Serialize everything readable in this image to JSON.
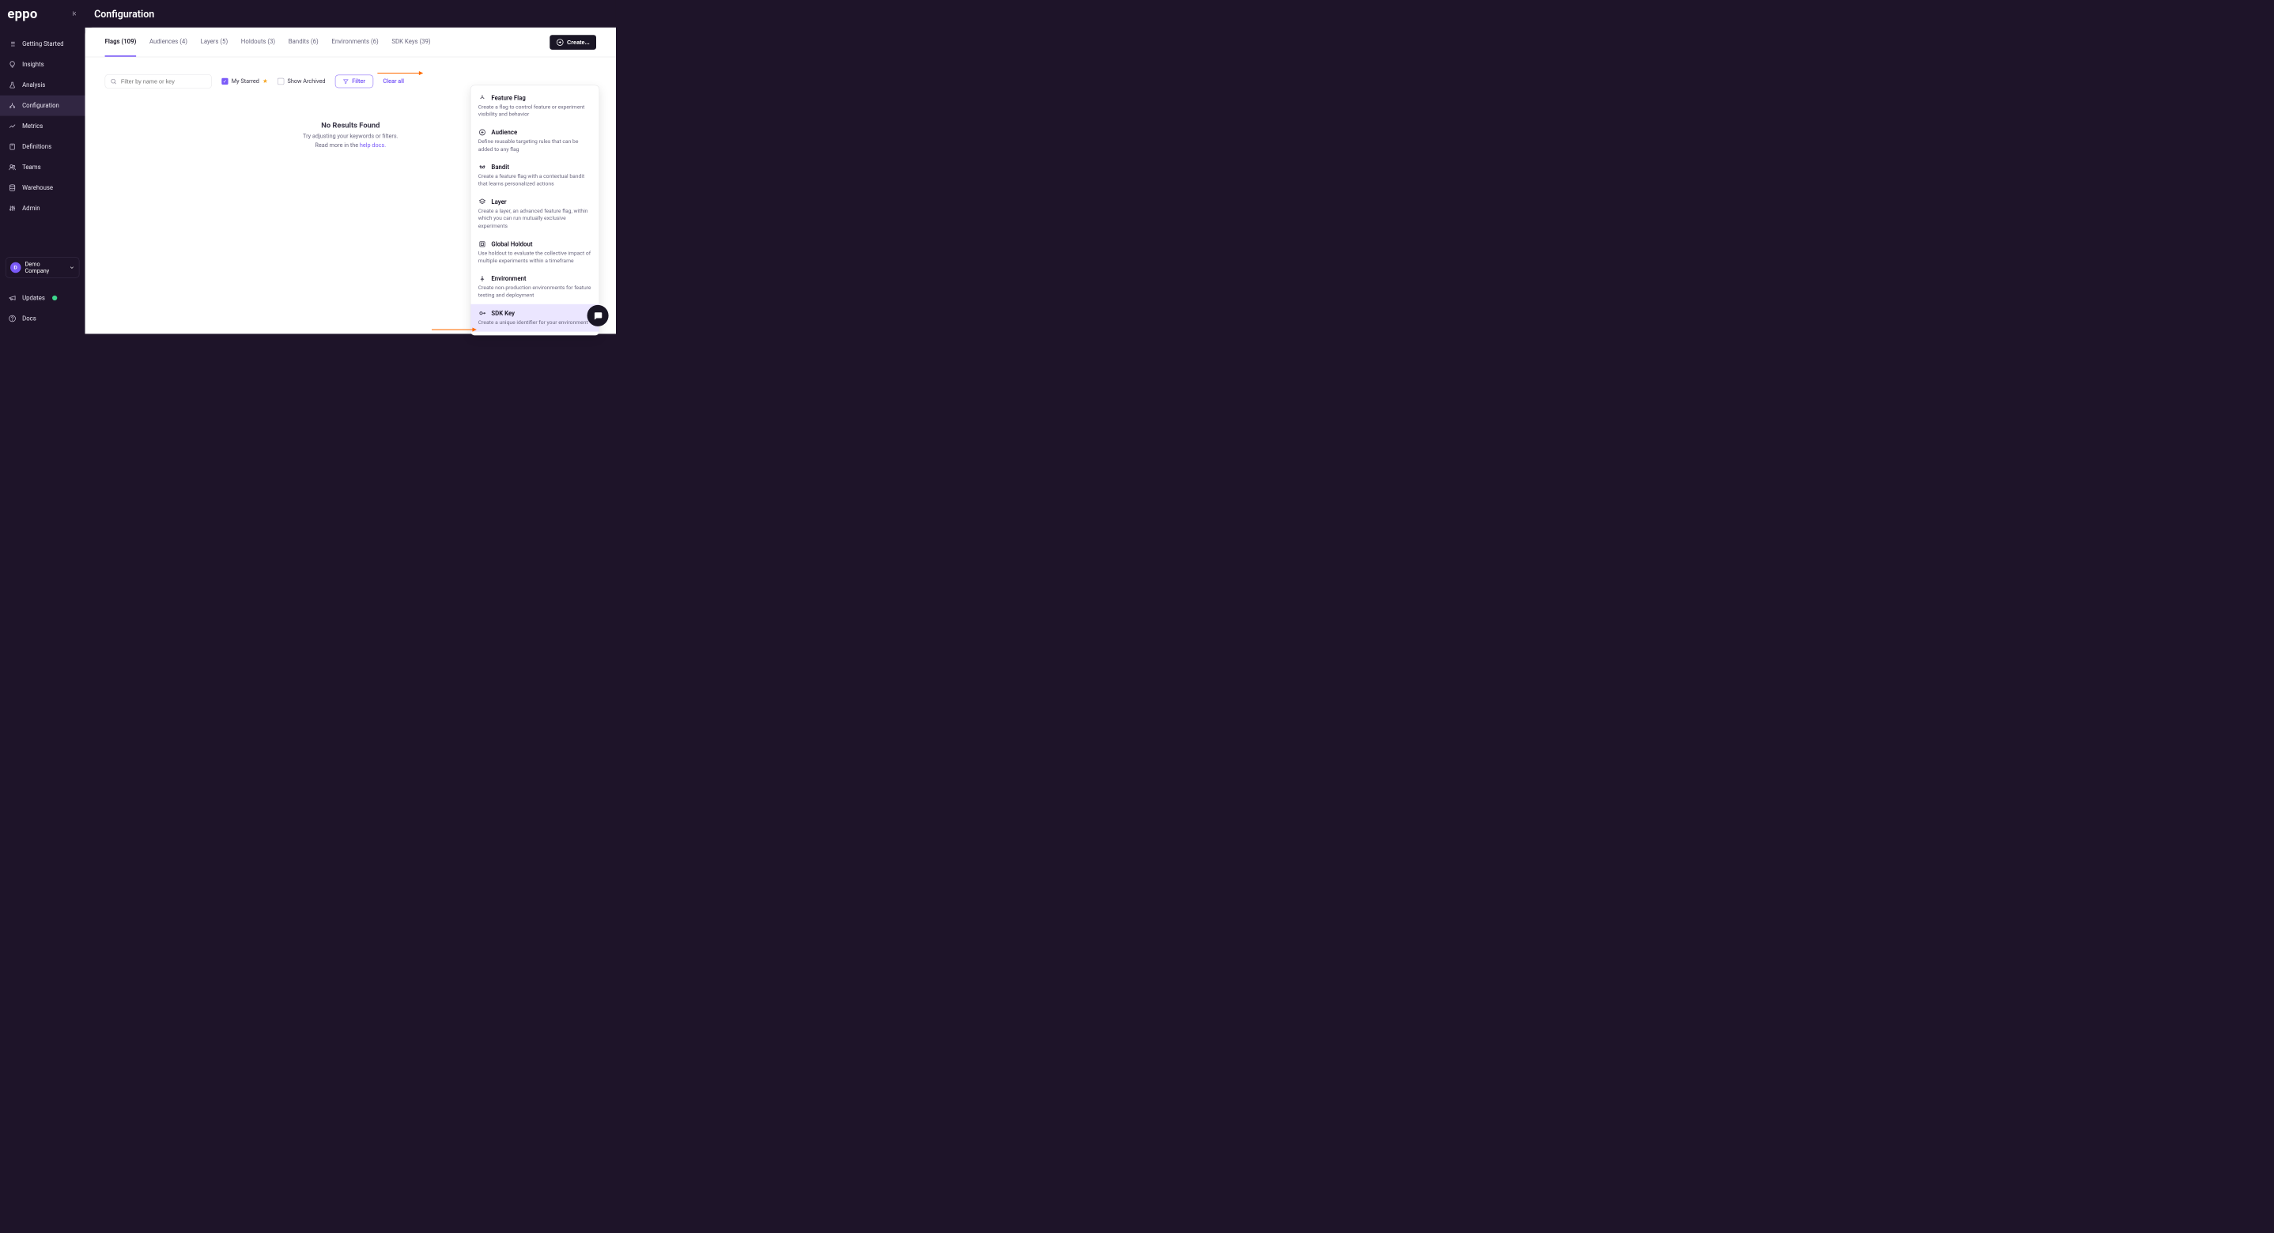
{
  "app_name": "eppo",
  "page_title": "Configuration",
  "collapse_label": "Collapse sidebar",
  "sidebar": {
    "items": [
      {
        "label": "Getting Started",
        "icon": "list-steps-icon"
      },
      {
        "label": "Insights",
        "icon": "lightbulb-icon"
      },
      {
        "label": "Analysis",
        "icon": "flask-icon"
      },
      {
        "label": "Configuration",
        "icon": "branch-icon"
      },
      {
        "label": "Metrics",
        "icon": "chart-line-icon"
      },
      {
        "label": "Definitions",
        "icon": "book-icon"
      },
      {
        "label": "Teams",
        "icon": "users-icon"
      },
      {
        "label": "Warehouse",
        "icon": "database-icon"
      },
      {
        "label": "Admin",
        "icon": "sliders-icon"
      }
    ],
    "company": {
      "initial": "D",
      "name": "Demo Company"
    },
    "updates": "Updates",
    "docs": "Docs"
  },
  "tabs": [
    {
      "label": "Flags (109)",
      "active": true
    },
    {
      "label": "Audiences (4)"
    },
    {
      "label": "Layers (5)"
    },
    {
      "label": "Holdouts (3)"
    },
    {
      "label": "Bandits (6)"
    },
    {
      "label": "Environments (6)"
    },
    {
      "label": "SDK Keys (39)"
    }
  ],
  "create_button": "Create...",
  "toolbar": {
    "search_placeholder": "Filter by name or key",
    "my_starred": "My Starred",
    "show_archived": "Show Archived",
    "filter": "Filter",
    "clear_all": "Clear all"
  },
  "empty": {
    "title": "No Results Found",
    "subtitle": "Try adjusting your keywords or filters.",
    "read_more": "Read more in the ",
    "help_link": "help docs."
  },
  "create_menu": [
    {
      "title": "Feature Flag",
      "desc": "Create a flag to control feature or experiment visibility and behavior",
      "icon": "branch-icon"
    },
    {
      "title": "Audience",
      "desc": "Define reusable targeting rules that can be added to any flag",
      "icon": "target-icon"
    },
    {
      "title": "Bandit",
      "desc": "Create a feature flag with a contextual bandit that learns personalized actions",
      "icon": "bandit-icon"
    },
    {
      "title": "Layer",
      "desc": "Create a layer, an advanced feature flag, within which you can run mutually exclusive experiments",
      "icon": "layers-icon"
    },
    {
      "title": "Global Holdout",
      "desc": "Use holdout to evaluate the collective impact of multiple experiments within a timeframe",
      "icon": "holdout-icon"
    },
    {
      "title": "Environment",
      "desc": "Create non-production environments for feature testing and deployment",
      "icon": "pin-icon"
    },
    {
      "title": "SDK Key",
      "desc": "Create a unique identifier for your environment",
      "icon": "key-icon",
      "hovered": true
    }
  ]
}
